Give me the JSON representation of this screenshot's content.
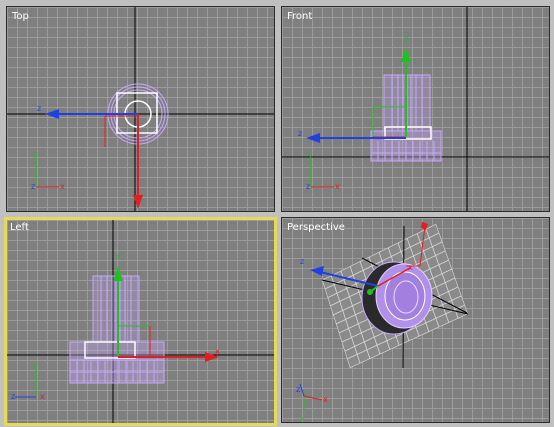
{
  "viewports": {
    "top": {
      "label": "Top"
    },
    "front": {
      "label": "Front"
    },
    "left": {
      "label": "Left"
    },
    "perspective": {
      "label": "Perspective"
    }
  },
  "axis_letters": {
    "x": "x",
    "y": "y",
    "z": "z"
  },
  "active_viewport": "left",
  "colors": {
    "viewport_bg": "#7f7f7f",
    "grid": "#a0a0a0",
    "active_border": "#e6d95a",
    "object": "#c8a8ff",
    "x_axis": "#e02020",
    "y_axis": "#20c020",
    "z_axis": "#2040e0"
  }
}
